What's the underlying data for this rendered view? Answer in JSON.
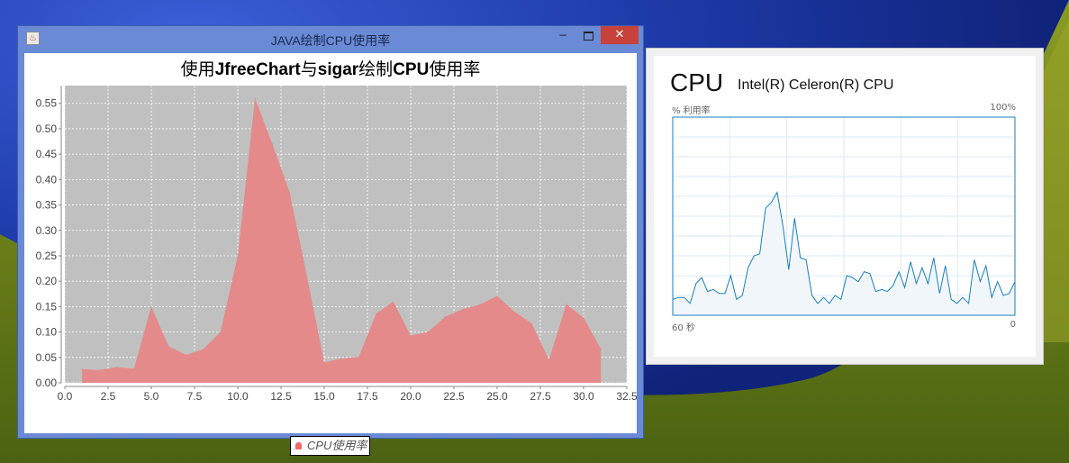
{
  "java_window": {
    "title": "JAVA绘制CPU使用率",
    "title_icon": "java-icon",
    "minimize_glyph": "−",
    "close_glyph": "✕"
  },
  "chart_title_parts": [
    "使用",
    "JfreeChart",
    "与",
    "sigar",
    "绘制",
    "CPU",
    "使用率"
  ],
  "chart_data": {
    "type": "area",
    "title": "使用JfreeChart与sigar绘制CPU使用率",
    "xlabel": "",
    "ylabel": "",
    "x": [
      1,
      2,
      3,
      4,
      5,
      6,
      7,
      8,
      9,
      10,
      11,
      12,
      13,
      14,
      15,
      16,
      17,
      18,
      19,
      20,
      21,
      22,
      23,
      24,
      25,
      26,
      27,
      28,
      29,
      30,
      31
    ],
    "series": [
      {
        "name": "CPU使用率",
        "values": [
          0.027,
          0.025,
          0.031,
          0.028,
          0.15,
          0.072,
          0.055,
          0.066,
          0.1,
          0.25,
          0.56,
          0.47,
          0.375,
          0.21,
          0.04,
          0.048,
          0.051,
          0.136,
          0.16,
          0.093,
          0.1,
          0.13,
          0.145,
          0.154,
          0.171,
          0.14,
          0.117,
          0.045,
          0.155,
          0.128,
          0.067
        ]
      }
    ],
    "xlim": [
      0,
      32.5
    ],
    "ylim": [
      0,
      0.585
    ],
    "x_ticks": [
      "0.0",
      "2.5",
      "5.0",
      "7.5",
      "10.0",
      "12.5",
      "15.0",
      "17.5",
      "20.0",
      "22.5",
      "25.0",
      "27.5",
      "30.0",
      "32.5"
    ],
    "y_ticks": [
      "0.00",
      "0.05",
      "0.10",
      "0.15",
      "0.20",
      "0.25",
      "0.30",
      "0.35",
      "0.40",
      "0.45",
      "0.50",
      "0.55"
    ],
    "grid": true,
    "legend": "bottom",
    "colors": {
      "area": "#e48a8a",
      "plot_bg": "#c0c0c0",
      "legend_swatch": "#f06a6a"
    }
  },
  "task_manager": {
    "heading": "CPU",
    "model": "Intel(R) Celeron(R) CPU",
    "ylabel": "% 利用率",
    "max_label": "100%",
    "x_left": "60 秒",
    "x_right": "0",
    "line_color": "#1a7fbf",
    "fill_color": "#f1f6fa",
    "grid_color": "#d9eaf4",
    "samples": [
      8,
      9,
      9,
      6,
      16,
      19,
      12,
      13,
      11,
      11,
      20,
      8,
      10,
      24,
      30,
      31,
      54,
      57,
      62,
      45,
      23,
      49,
      29,
      28,
      10,
      6,
      9,
      6,
      10,
      8,
      20,
      19,
      17,
      22,
      21,
      12,
      13,
      12,
      15,
      22,
      14,
      27,
      16,
      24,
      16,
      29,
      11,
      25,
      8,
      6,
      9,
      6,
      28,
      17,
      25,
      9,
      17,
      10,
      11,
      17
    ]
  }
}
